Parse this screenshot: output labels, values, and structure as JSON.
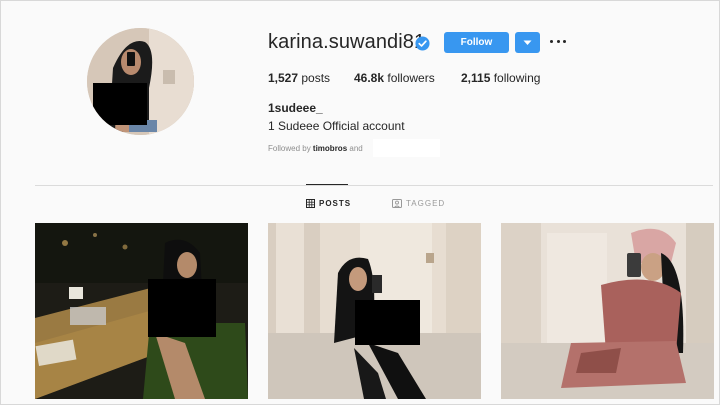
{
  "profile": {
    "username": "karina.suwandi81",
    "follow_label": "Follow",
    "stats": {
      "posts_value": "1,527",
      "posts_label": "posts",
      "followers_value": "46.8k",
      "followers_label": "followers",
      "following_value": "2,115",
      "following_label": "following"
    },
    "full_name": "1sudeee_",
    "bio": "1 Sudeee Official account",
    "followed_by_prefix": "Followed by",
    "followed_by_user": "timobros",
    "followed_by_suffix": "and"
  },
  "tabs": [
    {
      "label": "POSTS",
      "active": true,
      "icon": "grid-icon"
    },
    {
      "label": "TAGGED",
      "active": false,
      "icon": "tag-icon"
    }
  ],
  "colors": {
    "accent": "#3897f0",
    "background": "#fafafa",
    "text": "#262626",
    "muted": "#8e8e8e"
  }
}
